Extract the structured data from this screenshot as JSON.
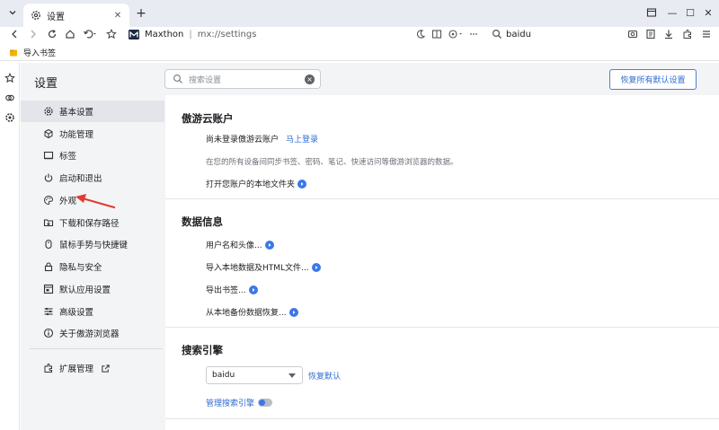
{
  "tab": {
    "title": "设置",
    "close": "✕"
  },
  "titlebar": {
    "new_tab": "+",
    "minimize": "—",
    "maximize": "☐",
    "close": "✕"
  },
  "address": {
    "site_name": "Maxthon",
    "separator": "|",
    "url": "mx://settings"
  },
  "search_engine_box": {
    "value": "baidu"
  },
  "bookmarks": {
    "import": "导入书签"
  },
  "settings": {
    "title": "设置",
    "search_placeholder": "搜索设置",
    "clear": "×",
    "reset_button": "恢复所有默认设置"
  },
  "nav": {
    "items": [
      {
        "label": "基本设置",
        "icon": "gear-icon",
        "active": true
      },
      {
        "label": "功能管理",
        "icon": "cube-icon"
      },
      {
        "label": "标签",
        "icon": "tab-icon"
      },
      {
        "label": "启动和退出",
        "icon": "power-icon"
      },
      {
        "label": "外观",
        "icon": "palette-icon"
      },
      {
        "label": "下载和保存路径",
        "icon": "folder-icon"
      },
      {
        "label": "鼠标手势与快捷键",
        "icon": "mouse-icon"
      },
      {
        "label": "隐私与安全",
        "icon": "lock-icon"
      },
      {
        "label": "默认应用设置",
        "icon": "window-icon"
      },
      {
        "label": "高级设置",
        "icon": "sliders-icon"
      },
      {
        "label": "关于傲游浏览器",
        "icon": "info-icon"
      }
    ],
    "extensions": {
      "label": "扩展管理",
      "icon": "puzzle-icon"
    }
  },
  "content": {
    "account": {
      "title": "傲游云账户",
      "not_logged": "尚未登录傲游云账户",
      "login_link": "马上登录",
      "description": "在您的所有设备间同步书签、密码、笔记、快速访问等傲游浏览器的数据。",
      "open_folder": "打开您账户的本地文件夹"
    },
    "data": {
      "title": "数据信息",
      "items": [
        "用户名和头像...",
        "导入本地数据及HTML文件...",
        "导出书签...",
        "从本地备份数据恢复..."
      ]
    },
    "search": {
      "title": "搜索引擎",
      "selected": "baidu",
      "restore_default": "恢复默认",
      "manage": "管理搜索引擎",
      "toggle_on": true
    }
  },
  "colors": {
    "accent": "#3b78e7",
    "link": "#2f6dd0",
    "annotation_arrow": "#e03c31"
  }
}
